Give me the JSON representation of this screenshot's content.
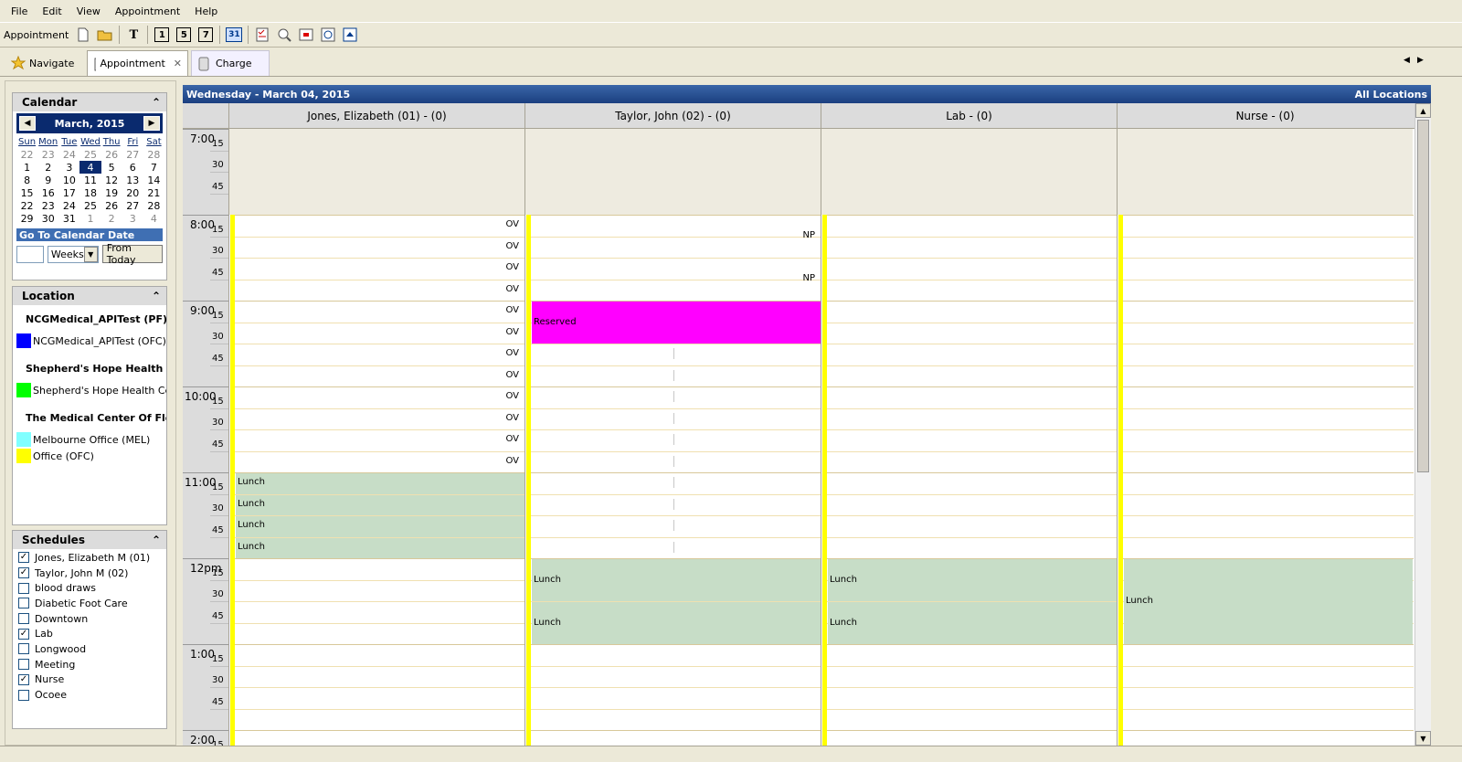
{
  "menu": [
    "File",
    "Edit",
    "View",
    "Appointment",
    "Help"
  ],
  "toolbar": {
    "label": "Appointment",
    "view_1": "1",
    "view_5": "5",
    "view_7": "7",
    "view_31": "31",
    "text_tool": "T"
  },
  "tabs": {
    "navigate": "Navigate",
    "appointment": "Appointment",
    "charge": "Charge",
    "close": "✕"
  },
  "calendar": {
    "title": "Calendar",
    "month": "March, 2015",
    "weekdays": [
      "Sun",
      "Mon",
      "Tue",
      "Wed",
      "Thu",
      "Fri",
      "Sat"
    ],
    "weeks": [
      [
        "22",
        "23",
        "24",
        "25",
        "26",
        "27",
        "28"
      ],
      [
        "1",
        "2",
        "3",
        "4",
        "5",
        "6",
        "7"
      ],
      [
        "8",
        "9",
        "10",
        "11",
        "12",
        "13",
        "14"
      ],
      [
        "15",
        "16",
        "17",
        "18",
        "19",
        "20",
        "21"
      ],
      [
        "22",
        "23",
        "24",
        "25",
        "26",
        "27",
        "28"
      ],
      [
        "29",
        "30",
        "31",
        "1",
        "2",
        "3",
        "4"
      ]
    ],
    "selected": "4",
    "goto_label": "Go To Calendar Date",
    "unit": "Weeks",
    "from_today": "From Today"
  },
  "location": {
    "title": "Location",
    "groups": [
      {
        "name": "NCGMedical_APITest (PF)",
        "items": [
          {
            "name": "NCGMedical_APITest (OFC)",
            "color": "#0000ff"
          }
        ]
      },
      {
        "name": "Shepherd's Hope Health Cen",
        "items": [
          {
            "name": "Shepherd's Hope Health Ce...",
            "color": "#00ff00"
          }
        ]
      },
      {
        "name": "The Medical Center Of Florid",
        "items": [
          {
            "name": "Melbourne Office (MEL)",
            "color": "#80ffff"
          },
          {
            "name": "Office (OFC)",
            "color": "#ffff00"
          }
        ]
      }
    ]
  },
  "schedules": {
    "title": "Schedules",
    "items": [
      {
        "name": "Jones, Elizabeth M (01)",
        "checked": true
      },
      {
        "name": "Taylor, John M (02)",
        "checked": true
      },
      {
        "name": "blood draws",
        "checked": false
      },
      {
        "name": "Diabetic Foot Care",
        "checked": false
      },
      {
        "name": "Downtown",
        "checked": false
      },
      {
        "name": "Lab",
        "checked": true
      },
      {
        "name": "Longwood",
        "checked": false
      },
      {
        "name": "Meeting",
        "checked": false
      },
      {
        "name": "Nurse",
        "checked": true
      },
      {
        "name": "Ocoee",
        "checked": false
      }
    ]
  },
  "day": {
    "date": "Wednesday - March 04, 2015",
    "scope": "All Locations"
  },
  "columns": [
    "Jones, Elizabeth (01) - (0)",
    "Taylor, John (02) - (0)",
    "Lab - (0)",
    "Nurse - (0)"
  ],
  "hours": [
    "7:00",
    "8:00",
    "9:00",
    "10:00",
    "11:00",
    "12pm",
    "1:00",
    "2:00"
  ],
  "minutes": [
    "15",
    "30",
    "45"
  ],
  "ov_label": "OV",
  "np_label": "NP",
  "reserved": "Reserved",
  "lunch": "Lunch",
  "colors": {
    "reserved": "#ff00ff",
    "lunch": "#c7ddc7",
    "offhours": "#eeebe0",
    "yellow": "#ffff00"
  }
}
